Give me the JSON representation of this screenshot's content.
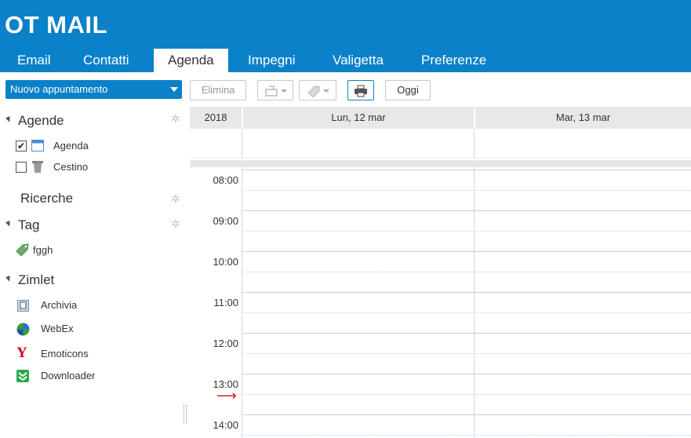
{
  "header": {
    "logo": "OT MAIL",
    "brand_color": "#0a81c9",
    "tabs": [
      {
        "label": "Email"
      },
      {
        "label": "Contatti"
      },
      {
        "label": "Agenda",
        "active": true
      },
      {
        "label": "Impegni"
      },
      {
        "label": "Valigetta"
      },
      {
        "label": "Preferenze"
      }
    ]
  },
  "toolbar": {
    "new_appointment": "Nuovo appuntamento",
    "delete": "Elimina",
    "move_icon": "move-icon",
    "tag_icon": "tag-icon",
    "print_icon": "printer-icon",
    "today": "Oggi"
  },
  "sidebar": {
    "calendars": {
      "title": "Agende",
      "items": [
        {
          "label": "Agenda",
          "checked": true,
          "icon": "calendar-icon"
        },
        {
          "label": "Cestino",
          "checked": false,
          "icon": "trash-icon"
        }
      ]
    },
    "searches": {
      "title": "Ricerche"
    },
    "tags": {
      "title": "Tag",
      "items": [
        {
          "label": "fggh",
          "icon": "tag-icon"
        }
      ]
    },
    "zimlets": {
      "title": "Zimlet",
      "items": [
        {
          "label": "Archivia",
          "icon": "archive-icon"
        },
        {
          "label": "WebEx",
          "icon": "webex-icon"
        },
        {
          "label": "Emoticons",
          "icon": "yahoo-icon"
        },
        {
          "label": "Downloader",
          "icon": "download-icon"
        }
      ]
    }
  },
  "calendar": {
    "year": "2018",
    "days": [
      "Lun, 12 mar",
      "Mar, 13 mar"
    ],
    "hours": [
      "08:00",
      "09:00",
      "10:00",
      "11:00",
      "12:00",
      "13:00",
      "14:00"
    ],
    "current_time_icon": "current-time-arrow-icon"
  }
}
